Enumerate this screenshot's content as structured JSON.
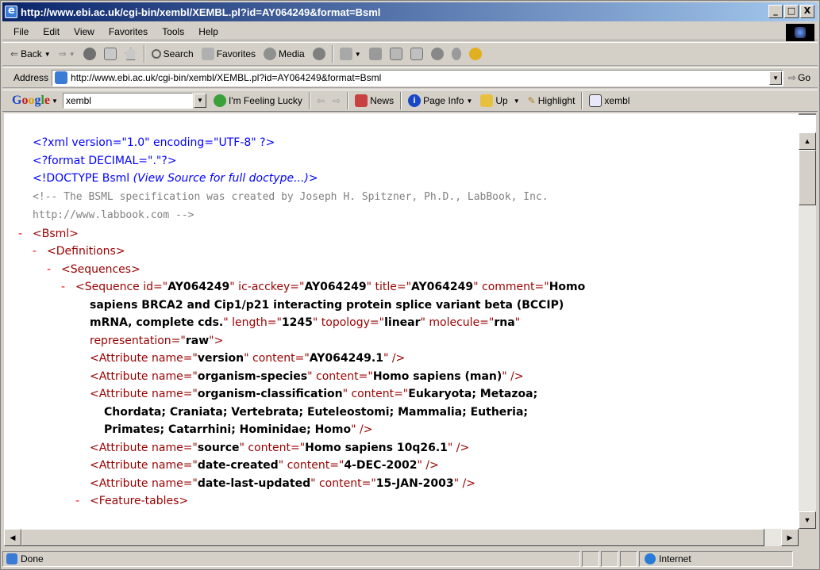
{
  "window": {
    "title": "http://www.ebi.ac.uk/cgi-bin/xembl/XEMBL.pl?id=AY064249&format=Bsml",
    "controls": [
      "_",
      "□",
      "X"
    ]
  },
  "menu": [
    "File",
    "Edit",
    "View",
    "Favorites",
    "Tools",
    "Help"
  ],
  "toolbar": {
    "back": "Back",
    "search": "Search",
    "favorites": "Favorites",
    "media": "Media"
  },
  "address": {
    "label": "Address",
    "url": "http://www.ebi.ac.uk/cgi-bin/xembl/XEMBL.pl?id=AY064249&format=Bsml",
    "go": "Go"
  },
  "google": {
    "logo": {
      "G": "G",
      "o1": "o",
      "o2": "o",
      "g": "g",
      "l": "l",
      "e": "e"
    },
    "query": "xembl",
    "lucky": "I'm Feeling Lucky",
    "news": "News",
    "page_info": "Page Info",
    "up": "Up",
    "highlight": "Highlight",
    "term": "xembl"
  },
  "xml": {
    "l1": "<?xml version=\"1.0\" encoding=\"UTF-8\" ?>",
    "l2": "<?format DECIMAL=\".\"?>",
    "l3_tag": "<!DOCTYPE Bsml",
    "l3_note": "(View Source for full doctype...)",
    "l3_end": ">",
    "l4": "<!-- The BSML specification was created by Joseph H. Spitzner, Ph.D., LabBook, Inc.",
    "l5": "http://www.labbook.com -->",
    "l6": "<Bsml>",
    "l7": "<Definitions>",
    "l8": "<Sequences>",
    "seq_open": "<Sequence",
    "seq_id_attr": " id=\"",
    "seq_id": "AY064249",
    "seq_ickey_attr": "\" ic-acckey=\"",
    "seq_ickey": "AY064249",
    "seq_title_attr": "\" title=\"",
    "seq_title": "AY064249",
    "seq_comment_attr": "\" comment=\"",
    "seq_comment_1": "Homo",
    "seq_comment_2": "sapiens BRCA2 and Cip1/p21 interacting protein splice variant beta (BCCIP)",
    "seq_comment_3": "mRNA, complete cds.",
    "seq_length_attr": "\" length=\"",
    "seq_length": "1245",
    "seq_topology_attr": "\" topology=\"",
    "seq_topology": "linear",
    "seq_molecule_attr": "\" molecule=\"",
    "seq_molecule": "rna",
    "seq_close_q": "\"",
    "seq_repr_attr": "representation=\"",
    "seq_repr": "raw",
    "seq_end": "\">",
    "a_open": "<Attribute name=\"",
    "a_mid": "\" content=\"",
    "a_close": "\" />",
    "attrs": [
      {
        "name": "version",
        "content": "AY064249.1"
      },
      {
        "name": "organism-species",
        "content": "Homo sapiens (man)"
      },
      {
        "name": "organism-classification",
        "content_1": "Eukaryota; Metazoa;",
        "content_2": "Chordata; Craniata; Vertebrata; Euteleostomi; Mammalia; Eutheria;",
        "content_3": "Primates; Catarrhini; Hominidae; Homo"
      },
      {
        "name": "source",
        "content": "Homo sapiens 10q26.1"
      },
      {
        "name": "date-created",
        "content": "4-DEC-2002"
      },
      {
        "name": "date-last-updated",
        "content": "15-JAN-2003"
      }
    ],
    "feature_tables": "<Feature-tables>",
    "minus": "-"
  },
  "status": {
    "text": "Done",
    "zone": "Internet"
  }
}
